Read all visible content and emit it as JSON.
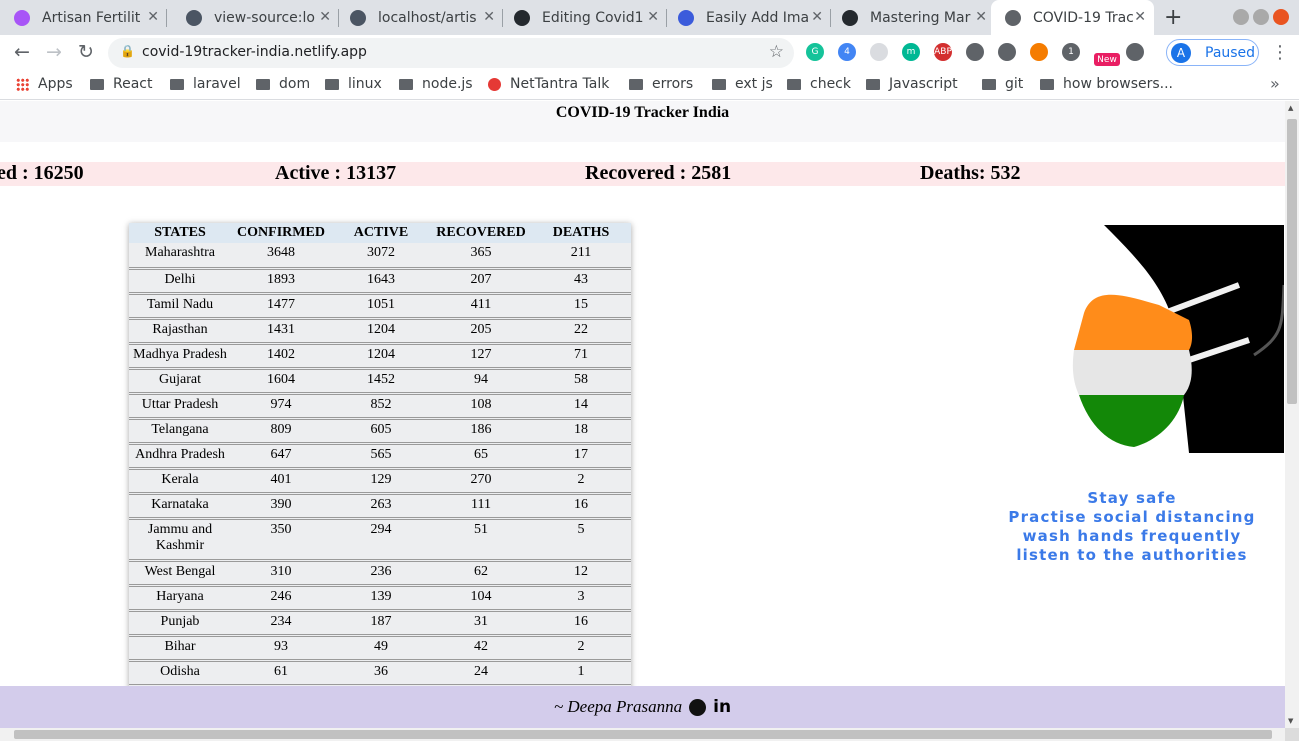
{
  "browser": {
    "tabs": [
      {
        "title": "Artisan Fertilit",
        "favicon_color": "#a855f7"
      },
      {
        "title": "view-source:lo",
        "favicon_color": "#4b5563"
      },
      {
        "title": "localhost/artis",
        "favicon_color": "#4b5563"
      },
      {
        "title": "Editing Covid1",
        "favicon_color": "#24292e"
      },
      {
        "title": "Easily Add Ima",
        "favicon_color": "#3b5bdb"
      },
      {
        "title": "Mastering Mar",
        "favicon_color": "#24292e"
      },
      {
        "title": "COVID-19 Trac",
        "favicon_color": "#5f6368"
      }
    ],
    "active_tab": 6,
    "url": "covid-19tracker-india.netlify.app",
    "profile_initial": "A",
    "profile_status": "Paused",
    "extensions": [
      {
        "name": "grammarly-icon",
        "label": "G",
        "color": "#15c39a"
      },
      {
        "name": "checklist-icon",
        "label": "4",
        "color": "#4285f4"
      },
      {
        "name": "screenshot-icon",
        "label": "",
        "color": "#dadce0"
      },
      {
        "name": "m-icon",
        "label": "m",
        "color": "#00b894"
      },
      {
        "name": "adblock-icon",
        "label": "ABP",
        "color": "#d32f2f"
      },
      {
        "name": "page-icon",
        "label": "",
        "color": "#5f6368"
      },
      {
        "name": "eyedropper-icon",
        "label": "",
        "color": "#5f6368"
      },
      {
        "name": "bottle-icon",
        "label": "",
        "color": "#f57c00"
      },
      {
        "name": "puzzle-icon",
        "label": "1",
        "color": "#5f6368"
      },
      {
        "name": "new-badge-icon",
        "label": "New",
        "color": "#e91e63"
      },
      {
        "name": "code-icon",
        "label": "",
        "color": "#5f6368"
      }
    ]
  },
  "bookmarks": [
    {
      "label": "Apps",
      "kind": "apps"
    },
    {
      "label": "React",
      "kind": "folder"
    },
    {
      "label": "laravel",
      "kind": "folder"
    },
    {
      "label": "dom",
      "kind": "folder"
    },
    {
      "label": "linux",
      "kind": "folder"
    },
    {
      "label": "node.js",
      "kind": "folder"
    },
    {
      "label": "NetTantra Talk",
      "kind": "link"
    },
    {
      "label": "errors",
      "kind": "folder"
    },
    {
      "label": "ext js",
      "kind": "folder"
    },
    {
      "label": "check",
      "kind": "folder"
    },
    {
      "label": "Javascript",
      "kind": "folder"
    },
    {
      "label": "git",
      "kind": "folder"
    },
    {
      "label": "how browsers...",
      "kind": "folder"
    }
  ],
  "page": {
    "title": "COVID-19 Tracker India",
    "stats": {
      "confirmed": "ed : 16250",
      "active": "Active : 13137",
      "recovered": "Recovered : 2581",
      "deaths": "Deaths: 532"
    },
    "table": {
      "headers": [
        "STATES",
        "CONFIRMED",
        "ACTIVE",
        "RECOVERED",
        "DEATHS"
      ],
      "rows": [
        [
          "Maharashtra",
          "3648",
          "3072",
          "365",
          "211"
        ],
        [
          "Delhi",
          "1893",
          "1643",
          "207",
          "43"
        ],
        [
          "Tamil Nadu",
          "1477",
          "1051",
          "411",
          "15"
        ],
        [
          "Rajasthan",
          "1431",
          "1204",
          "205",
          "22"
        ],
        [
          "Madhya Pradesh",
          "1402",
          "1204",
          "127",
          "71"
        ],
        [
          "Gujarat",
          "1604",
          "1452",
          "94",
          "58"
        ],
        [
          "Uttar Pradesh",
          "974",
          "852",
          "108",
          "14"
        ],
        [
          "Telangana",
          "809",
          "605",
          "186",
          "18"
        ],
        [
          "Andhra Pradesh",
          "647",
          "565",
          "65",
          "17"
        ],
        [
          "Kerala",
          "401",
          "129",
          "270",
          "2"
        ],
        [
          "Karnataka",
          "390",
          "263",
          "111",
          "16"
        ],
        [
          "Jammu and Kashmir",
          "350",
          "294",
          "51",
          "5"
        ],
        [
          "West Bengal",
          "310",
          "236",
          "62",
          "12"
        ],
        [
          "Haryana",
          "246",
          "139",
          "104",
          "3"
        ],
        [
          "Punjab",
          "234",
          "187",
          "31",
          "16"
        ],
        [
          "Bihar",
          "93",
          "49",
          "42",
          "2"
        ],
        [
          "Odisha",
          "61",
          "36",
          "24",
          "1"
        ]
      ]
    },
    "tips": [
      "Stay safe",
      "Practise social distancing",
      "wash hands frequently",
      "listen to the authorities"
    ],
    "footer": {
      "author": "~ Deepa Prasanna",
      "linkedin_text": "in"
    }
  },
  "colors": {
    "stats_band": "#fde8ea",
    "footer_band": "#d3cceb",
    "tips_text": "#3b7ae8",
    "mask_saffron": "#ff8c1a",
    "mask_white": "#e6e6e6",
    "mask_green": "#138808"
  }
}
